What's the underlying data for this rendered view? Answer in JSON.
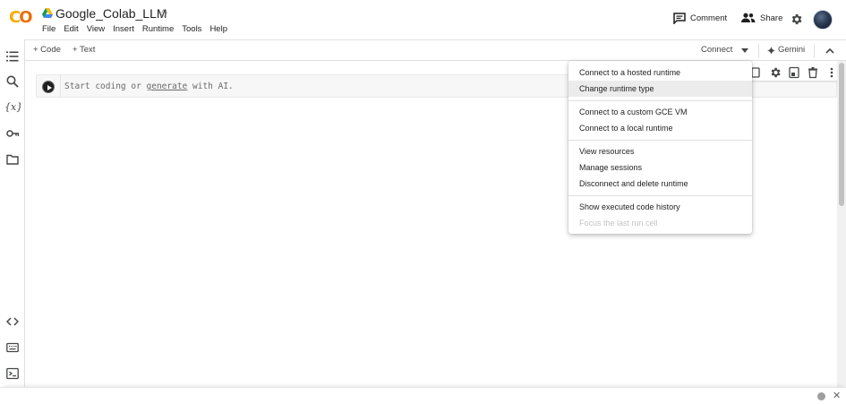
{
  "app": {
    "logo_text": "CO",
    "notebook_title": "Google_Colab_LLM",
    "star_glyph": "☆",
    "colors": {
      "brand_yellow": "#f9ab00",
      "brand_orange": "#e8710a"
    }
  },
  "menubar": [
    "File",
    "Edit",
    "View",
    "Insert",
    "Runtime",
    "Tools",
    "Help"
  ],
  "header_actions": {
    "comment_label": "Comment",
    "share_label": "Share"
  },
  "toolbar": {
    "add_code_label": "+ Code",
    "add_text_label": "+ Text",
    "connect_label": "Connect",
    "gemini_label": "Gemini"
  },
  "cell": {
    "placeholder_prefix": "Start coding or ",
    "placeholder_link": "generate",
    "placeholder_suffix": " with AI."
  },
  "runtime_menu": {
    "group1": [
      "Connect to a hosted runtime",
      "Change runtime type"
    ],
    "group2": [
      "Connect to a custom GCE VM",
      "Connect to a local runtime"
    ],
    "group3": [
      "View resources",
      "Manage sessions",
      "Disconnect and delete runtime"
    ],
    "group4": [
      "Show executed code history",
      "Focus the last run cell"
    ],
    "highlighted": "Change runtime type",
    "disabled": "Focus the last run cell"
  },
  "rail_icons": [
    "table-of-contents-icon",
    "search-icon",
    "variables-icon",
    "secrets-key-icon",
    "files-folder-icon",
    "code-snippets-icon",
    "command-palette-icon",
    "terminal-icon"
  ]
}
